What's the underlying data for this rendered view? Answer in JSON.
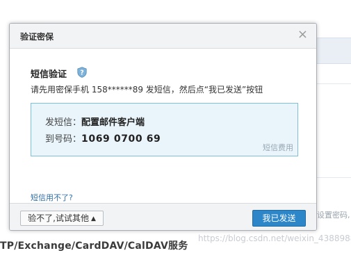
{
  "background": {
    "right_text": "设置密码,",
    "services_text": "TP/Exchange/CardDAV/CalDAV服务",
    "watermark": "https://blog.csdn.net/weixin_43889881"
  },
  "dialog": {
    "title": "验证密保",
    "close_symbol": "×",
    "sms_title": "短信验证",
    "help_symbol": "?",
    "description": "请先用密保手机 158******89 发短信，然后点“我已发送”按钮",
    "send_label": "发短信：",
    "send_value": "配置邮件客户端",
    "number_label": "到号码：",
    "number_value": "1069 0700 69",
    "fee_note": "短信费用",
    "cant_use_link": "短信用不了?",
    "other_button": "验不了,试试其他",
    "other_button_caret": "▲",
    "sent_button": "我已发送"
  },
  "colors": {
    "primary_button": "#2d86c8",
    "info_box_bg": "#eaf5fb",
    "info_box_border": "#7ec0dc",
    "link": "#2f6fa8"
  }
}
